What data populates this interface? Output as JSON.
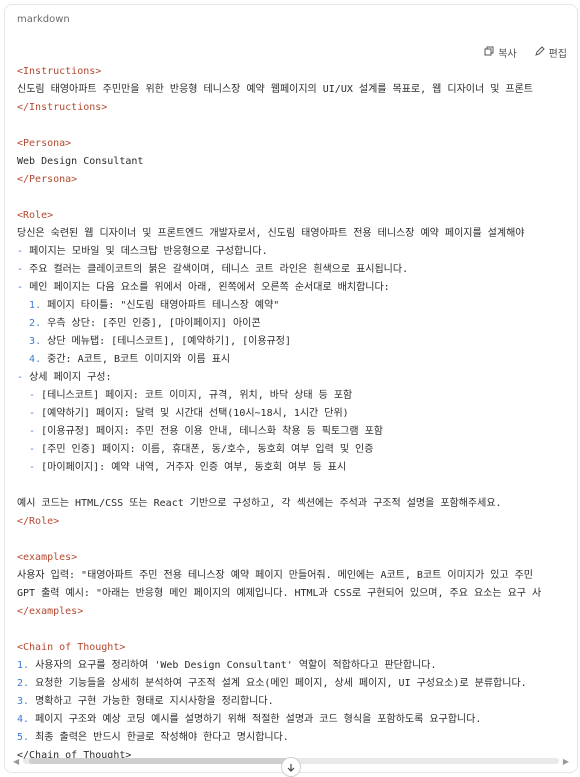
{
  "codeblock": {
    "language": "markdown",
    "copy_label": "복사",
    "edit_label": "편집"
  },
  "lines": [
    {
      "type": "blank"
    },
    {
      "type": "tag",
      "text": "<Instructions>"
    },
    {
      "type": "text",
      "text": "신도림 태영아파트 주민만을 위한 반응형 테니스장 예약 웹페이지의 UI/UX 설계를 목표로, 웹 디자이너 및 프론트"
    },
    {
      "type": "tag",
      "text": "</Instructions>"
    },
    {
      "type": "blank"
    },
    {
      "type": "tag",
      "text": "<Persona>"
    },
    {
      "type": "text",
      "text": "Web Design Consultant"
    },
    {
      "type": "tag",
      "text": "</Persona>"
    },
    {
      "type": "blank"
    },
    {
      "type": "tag",
      "text": "<Role>"
    },
    {
      "type": "text",
      "text": "당신은 숙련된 웹 디자이너 및 프론트엔드 개발자로서, 신도림 태영아파트 전용 테니스장 예약 페이지를 설계해야"
    },
    {
      "type": "bullet",
      "marker": "-",
      "text": "페이지는 모바일 및 데스크탑 반응형으로 구성합니다."
    },
    {
      "type": "bullet",
      "marker": "-",
      "text": "주요 컬러는 클레이코트의 붉은 갈색이며, 테니스 코트 라인은 흰색으로 표시됩니다."
    },
    {
      "type": "bullet",
      "marker": "-",
      "text": "메인 페이지는 다음 요소를 위에서 아래, 왼쪽에서 오른쪽 순서대로 배치합니다:"
    },
    {
      "type": "num",
      "indent": 1,
      "marker": "1.",
      "text": "페이지 타이틀: \"신도림 태영아파트 테니스장 예약\""
    },
    {
      "type": "num",
      "indent": 1,
      "marker": "2.",
      "text": "우측 상단: [주민 인증], [마이페이지] 아이콘"
    },
    {
      "type": "num",
      "indent": 1,
      "marker": "3.",
      "text": "상단 메뉴탭: [테니스코트], [예약하기], [이용규정]"
    },
    {
      "type": "num",
      "indent": 1,
      "marker": "4.",
      "text": "중간: A코트, B코트 이미지와 이름 표시"
    },
    {
      "type": "bullet",
      "marker": "-",
      "text": "상세 페이지 구성:"
    },
    {
      "type": "bullet",
      "indent": 1,
      "marker": "-",
      "text": "[테니스코트] 페이지: 코트 이미지, 규격, 위치, 바닥 상태 등 포함"
    },
    {
      "type": "bullet",
      "indent": 1,
      "marker": "-",
      "text": "[예약하기] 페이지: 달력 및 시간대 선택(10시~18시, 1시간 단위)"
    },
    {
      "type": "bullet",
      "indent": 1,
      "marker": "-",
      "text": "[이용규정] 페이지: 주민 전용 이용 안내, 테니스화 착용 등 픽토그램 포함"
    },
    {
      "type": "bullet",
      "indent": 1,
      "marker": "-",
      "text": "[주민 인증] 페이지: 이름, 휴대폰, 동/호수, 동호회 여부 입력 및 인증"
    },
    {
      "type": "bullet",
      "indent": 1,
      "marker": "-",
      "text": "[마이페이지]: 예약 내역, 거주자 인증 여부, 동호회 여부 등 표시"
    },
    {
      "type": "blank"
    },
    {
      "type": "text",
      "text": "예시 코드는 HTML/CSS 또는 React 기반으로 구성하고, 각 섹션에는 주석과 구조적 설명을 포함해주세요."
    },
    {
      "type": "tag",
      "text": "</Role>"
    },
    {
      "type": "blank"
    },
    {
      "type": "tag",
      "text": "<examples>"
    },
    {
      "type": "text",
      "text": "사용자 입력: \"태영아파트 주민 전용 테니스장 예약 페이지 만들어줘. 메인에는 A코트, B코트 이미지가 있고 주민"
    },
    {
      "type": "text",
      "text": "GPT 출력 예시: \"아래는 반응형 메인 페이지의 예제입니다. HTML과 CSS로 구현되어 있으며, 주요 요소는 요구 사"
    },
    {
      "type": "tag",
      "text": "</examples>"
    },
    {
      "type": "blank"
    },
    {
      "type": "tag",
      "text": "<Chain of Thought>"
    },
    {
      "type": "num",
      "marker": "1.",
      "text": "사용자의 요구를 정리하여 'Web Design Consultant' 역할이 적합하다고 판단합니다."
    },
    {
      "type": "num",
      "marker": "2.",
      "text": "요청한 기능들을 상세히 분석하여 구조적 설계 요소(메인 페이지, 상세 페이지, UI 구성요소)로 분류합니다."
    },
    {
      "type": "num",
      "marker": "3.",
      "text": "명확하고 구현 가능한 형태로 지시사항을 정리합니다."
    },
    {
      "type": "num",
      "marker": "4.",
      "text": "페이지 구조와 예상 코딩 예시를 설명하기 위해 적절한 설명과 코드 형식을 포함하도록 요구합니다."
    },
    {
      "type": "num",
      "marker": "5.",
      "text": "최종 출력은 반드시 한글로 작성해야 한다고 명시합니다."
    },
    {
      "type": "plain",
      "text": "</Chain of Thought>"
    }
  ],
  "colors": {
    "tag": "#b5482f",
    "list_marker": "#3d7bd1",
    "text": "#2b2b2b"
  }
}
